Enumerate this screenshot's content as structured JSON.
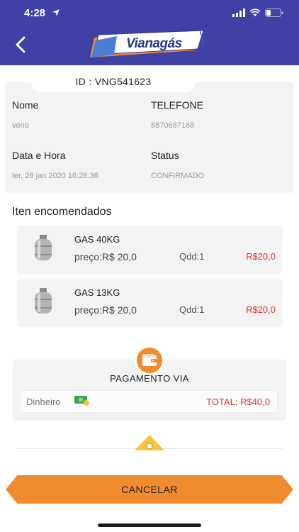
{
  "status_bar": {
    "time": "4:28"
  },
  "header": {
    "logo_text": "Vianagás"
  },
  "order": {
    "id_label": "ID : VNG541623",
    "name_label": "Nome",
    "name_value": "veno",
    "phone_label": "TELEFONE",
    "phone_value": "8870687168",
    "datetime_label": "Data e Hora",
    "datetime_value": "ter, 28 jan 2020 16:28:36",
    "status_label": "Status",
    "status_value": "CONFIRMADO"
  },
  "items_section": {
    "title": "Iten encomendados"
  },
  "items": [
    {
      "name": "GAS 40KG",
      "price": "preço:R$ 20,0",
      "qty": "Qdd:1",
      "total": "R$20,0"
    },
    {
      "name": "GAS 13KG",
      "price": "preço:R$ 20,0",
      "qty": "Qdd:1",
      "total": "R$20,0"
    }
  ],
  "payment": {
    "title": "PAGAMENTO VIA",
    "method": "Dinheiro",
    "total": "TOTAL: R$40,0"
  },
  "actions": {
    "cancel_label": "CANCELAR"
  },
  "colors": {
    "header": "#3f41a6",
    "accent": "#f08b2f",
    "price_red": "#e0342f"
  },
  "icons": [
    "location-arrow-icon",
    "signal-icon",
    "wifi-icon",
    "battery-icon",
    "back-chevron-icon",
    "gas-cylinder-icon",
    "wallet-icon",
    "cash-icon",
    "location-pin-icon"
  ]
}
